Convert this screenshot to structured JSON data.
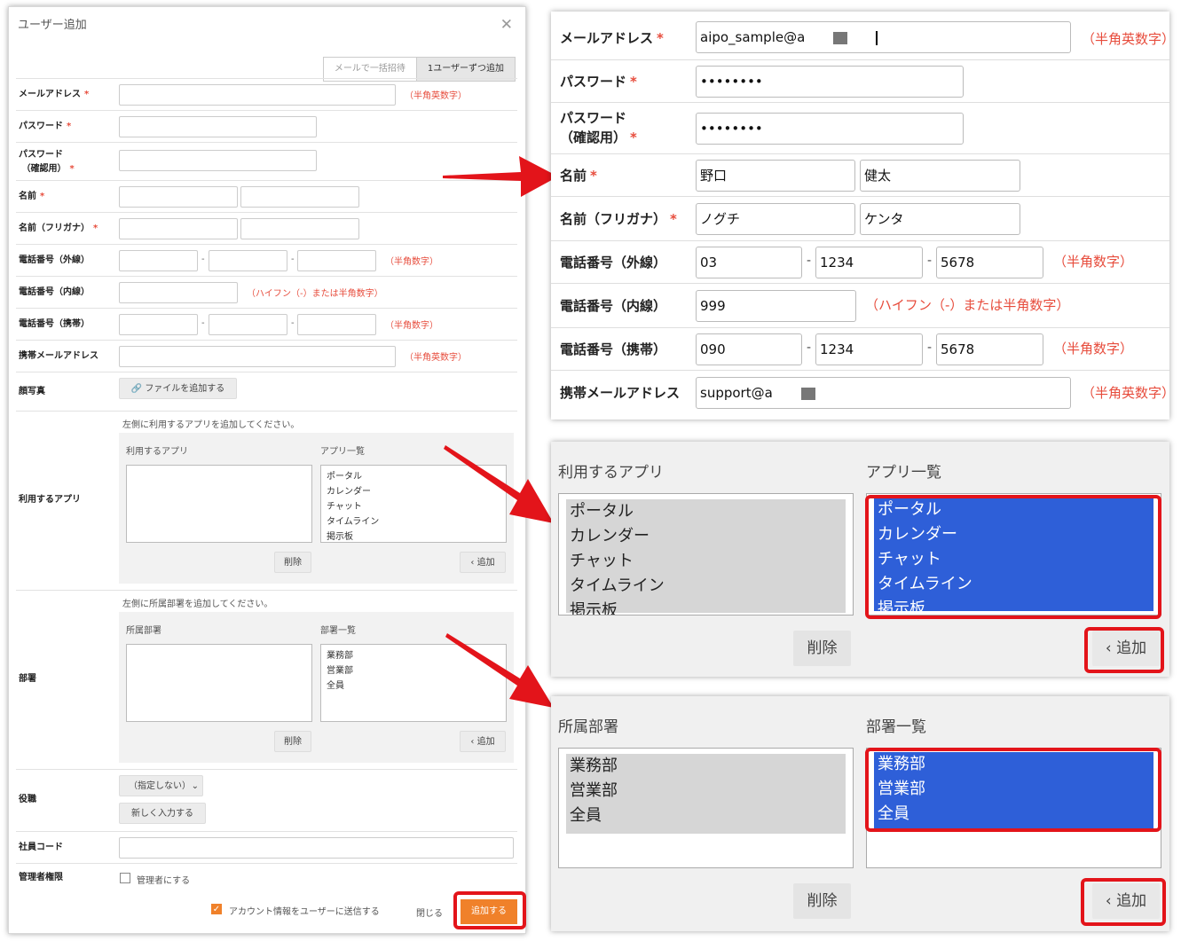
{
  "dialog": {
    "title": "ユーザー追加",
    "close_icon": "close-icon",
    "tabs": [
      "メールで一括招待",
      "1ユーザーずつ追加"
    ],
    "required_mark": "*",
    "fields": {
      "email": {
        "label": "メールアドレス",
        "hint": "（半角英数字）"
      },
      "password": {
        "label": "パスワード"
      },
      "password_confirm": {
        "label1": "パスワード",
        "label2": "（確認用）"
      },
      "name": {
        "label": "名前"
      },
      "name_kana": {
        "label": "名前（フリガナ）"
      },
      "phone_ext": {
        "label": "電話番号（外線）",
        "hint": "（半角数字）"
      },
      "phone_in": {
        "label": "電話番号（内線）",
        "hint": "（ハイフン（-）または半角数字）"
      },
      "phone_mobile": {
        "label": "電話番号（携帯）",
        "hint": "（半角数字）"
      },
      "mobile_email": {
        "label": "携帯メールアドレス",
        "hint": "（半角英数字）"
      },
      "photo": {
        "label": "顔写真",
        "button": "ファイルを追加する"
      },
      "apps": {
        "label": "利用するアプリ",
        "instruction": "左側に利用するアプリを追加してください。",
        "left_header": "利用するアプリ",
        "right_header": "アプリ一覧",
        "options": [
          "ポータル",
          "カレンダー",
          "チャット",
          "タイムライン",
          "掲示板"
        ],
        "delete_button": "削除",
        "add_button": "追加"
      },
      "dept": {
        "label": "部署",
        "instruction": "左側に所属部署を追加してください。",
        "left_header": "所属部署",
        "right_header": "部署一覧",
        "options": [
          "業務部",
          "営業部",
          "全員"
        ],
        "delete_button": "削除",
        "add_button": "追加"
      },
      "position": {
        "label": "役職",
        "select_value": "（指定しない）",
        "new_button": "新しく入力する"
      },
      "employee_code": {
        "label": "社員コード"
      },
      "admin": {
        "label": "管理者権限",
        "checkbox_label": "管理者にする"
      }
    },
    "footer": {
      "send_info": "アカウント情報をユーザーに送信する",
      "close": "閉じる",
      "submit": "追加する"
    }
  },
  "zoom_form": {
    "email": {
      "label": "メールアドレス",
      "value": "aipo_sample@a",
      "hint": "（半角英数字）"
    },
    "password": {
      "label": "パスワード",
      "value": "••••••••"
    },
    "password_confirm": {
      "label1": "パスワード",
      "label2": "（確認用）",
      "value": "••••••••"
    },
    "name": {
      "label": "名前",
      "last": "野口",
      "first": "健太"
    },
    "name_kana": {
      "label": "名前（フリガナ）",
      "last": "ノグチ",
      "first": "ケンタ"
    },
    "phone_ext": {
      "label": "電話番号（外線）",
      "v1": "03",
      "v2": "1234",
      "v3": "5678",
      "hint": "（半角数字）"
    },
    "phone_in": {
      "label": "電話番号（内線）",
      "value": "999",
      "hint": "（ハイフン（-）または半角数字）"
    },
    "phone_mobile": {
      "label": "電話番号（携帯）",
      "v1": "090",
      "v2": "1234",
      "v3": "5678",
      "hint": "（半角数字）"
    },
    "mobile_email": {
      "label": "携帯メールアドレス",
      "value": "support@a",
      "hint": "（半角英数字）"
    }
  },
  "zoom_apps": {
    "left_header": "利用するアプリ",
    "right_header": "アプリ一覧",
    "options": [
      "ポータル",
      "カレンダー",
      "チャット",
      "タイムライン",
      "掲示板"
    ],
    "delete_button": "削除",
    "add_button": "追加"
  },
  "zoom_dept": {
    "left_header": "所属部署",
    "right_header": "部署一覧",
    "options": [
      "業務部",
      "営業部",
      "全員"
    ],
    "delete_button": "削除",
    "add_button": "追加"
  },
  "colors": {
    "accent": "#f0812a",
    "highlight": "#e3141a",
    "selection": "#2e5fd8",
    "hint": "#e74c3c"
  }
}
